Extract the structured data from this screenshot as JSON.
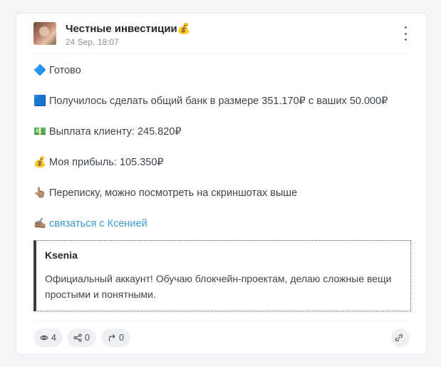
{
  "post": {
    "channel_title": "Честные инвестиции💰",
    "date": "24 Sep, 18:07"
  },
  "content": {
    "lines": [
      {
        "emoji": "🔷",
        "text": "Готово"
      },
      {
        "emoji": "🟦",
        "text": "Получилось сделать общий банк в размере 351.170₽ с ваших 50.000₽"
      },
      {
        "emoji": "💵",
        "text": "Выплата клиенту: 245.820₽"
      },
      {
        "emoji": "💰",
        "text": "Моя прибыль: 105.350₽"
      },
      {
        "emoji": "👆🏽",
        "text": "Переписку, можно посмотреть на скриншотах выше"
      }
    ],
    "contact": {
      "emoji": "✍🏽",
      "link_text": "связаться с Ксенией"
    }
  },
  "quote": {
    "author": "Ksenia",
    "text": "Официальный аккаунт! Обучаю блокчейн-проектам, делаю сложные вещи простыми и понятными."
  },
  "footer": {
    "views": "4",
    "shares": "0",
    "forwards": "0"
  },
  "colors": {
    "link": "#3a9ad1",
    "background": "#f4f5f7",
    "card": "#ffffff"
  },
  "icons": [
    "more-vertical-icon",
    "eye-icon",
    "share-icon",
    "forward-icon",
    "link-icon"
  ]
}
